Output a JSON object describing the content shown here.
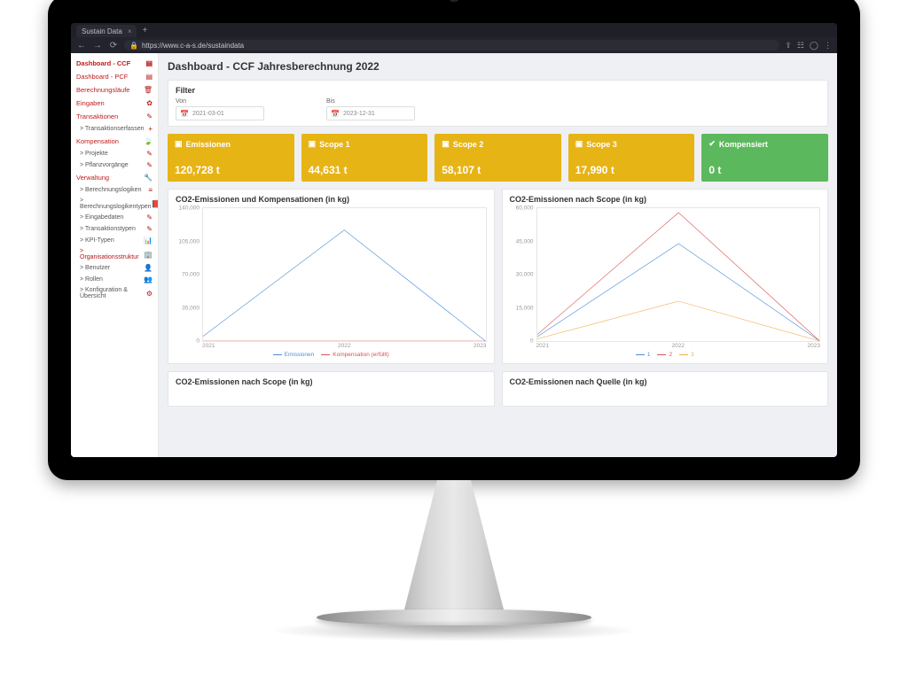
{
  "browser": {
    "tab_title": "Sustain Data",
    "url": "https://www.c-a-s.de/sustaindata"
  },
  "sidebar": {
    "items": [
      {
        "label": "Dashboard - CCF",
        "icon": "dashboard-icon",
        "glyph": "▤",
        "active": true
      },
      {
        "label": "Dashboard - PCF",
        "icon": "dashboard-icon",
        "glyph": "▤"
      },
      {
        "label": "Berechnungsläufe",
        "icon": "delete-icon",
        "glyph": "🗑"
      },
      {
        "label": "Eingaben",
        "icon": "settings-icon",
        "glyph": "✿"
      },
      {
        "label": "Transaktionen",
        "icon": "pencil-icon",
        "glyph": "✎"
      },
      {
        "label": "> Transaktionserfassen",
        "icon": "plus-icon",
        "glyph": "+",
        "sub": true
      },
      {
        "label": "Kompensation",
        "icon": "leaf-icon",
        "glyph": "🍃"
      },
      {
        "label": "> Projekte",
        "icon": "pencil-icon",
        "glyph": "✎",
        "sub": true
      },
      {
        "label": "> Pflanzvorgänge",
        "icon": "pencil-icon",
        "glyph": "✎",
        "sub": true
      },
      {
        "label": "Verwaltung",
        "icon": "wrench-icon",
        "glyph": "🔧"
      },
      {
        "label": "> Berechnungslogiken",
        "icon": "list-icon",
        "glyph": "≡",
        "sub": true
      },
      {
        "label": "> Berechnungslogikentypen",
        "icon": "book-icon",
        "glyph": "📕",
        "sub": true
      },
      {
        "label": "> Eingabedaten",
        "icon": "pencil-icon",
        "glyph": "✎",
        "sub": true
      },
      {
        "label": "> Transaktionstypen",
        "icon": "pencil-icon",
        "glyph": "✎",
        "sub": true
      },
      {
        "label": "> KPI-Typen",
        "icon": "chart-icon",
        "glyph": "📊",
        "sub": true
      },
      {
        "label": "> Organisationsstruktur",
        "icon": "org-icon",
        "glyph": "🏢",
        "sub": true,
        "active": true
      },
      {
        "label": "> Benutzer",
        "icon": "user-icon",
        "glyph": "👤",
        "sub": true
      },
      {
        "label": "> Rollen",
        "icon": "users-icon",
        "glyph": "👥",
        "sub": true
      },
      {
        "label": "> Konfiguration & Übersicht",
        "icon": "sliders-icon",
        "glyph": "⚙",
        "sub": true
      }
    ]
  },
  "page": {
    "title": "Dashboard - CCF Jahresberechnung 2022",
    "filter": {
      "title": "Filter",
      "from_label": "Von",
      "from_value": "2021-03-01",
      "to_label": "Bis",
      "to_value": "2023-12-31"
    },
    "cards": [
      {
        "icon": "folder-icon",
        "label": "Emissionen",
        "value": "120,728 t",
        "color": "yellow"
      },
      {
        "icon": "folder-icon",
        "label": "Scope 1",
        "value": "44,631 t",
        "color": "yellow"
      },
      {
        "icon": "folder-icon",
        "label": "Scope 2",
        "value": "58,107 t",
        "color": "yellow"
      },
      {
        "icon": "folder-icon",
        "label": "Scope 3",
        "value": "17,990 t",
        "color": "yellow"
      },
      {
        "icon": "check-icon",
        "label": "Kompensiert",
        "value": "0 t",
        "color": "green"
      }
    ],
    "chart1": {
      "title": "CO2-Emissionen und Kompensationen (in kg)"
    },
    "chart2": {
      "title": "CO2-Emissionen nach Scope (in kg)"
    },
    "chart3": {
      "title": "CO2-Emissionen nach Scope (in kg)"
    },
    "chart4": {
      "title": "CO2-Emissionen nach Quelle (in kg)"
    }
  },
  "chart_data": [
    {
      "type": "line",
      "title": "CO2-Emissionen und Kompensationen (in kg)",
      "x": [
        "2021",
        "2022",
        "2023"
      ],
      "series": [
        {
          "name": "Emissionen",
          "values": [
            5000,
            117000,
            0
          ],
          "color": "#4a90d9"
        },
        {
          "name": "Kompensation (erfüllt)",
          "values": [
            0,
            0,
            0
          ],
          "color": "#d9534f"
        }
      ],
      "ylim": [
        0,
        140000
      ],
      "yticks": [
        0,
        35000,
        70000,
        105000,
        140000
      ],
      "xlabel": "",
      "ylabel": ""
    },
    {
      "type": "line",
      "title": "CO2-Emissionen nach Scope (in kg)",
      "x": [
        "2021",
        "2022",
        "2023"
      ],
      "series": [
        {
          "name": "1",
          "values": [
            2000,
            44000,
            0
          ],
          "color": "#4a90d9"
        },
        {
          "name": "2",
          "values": [
            3000,
            58000,
            0
          ],
          "color": "#d9534f"
        },
        {
          "name": "3",
          "values": [
            1000,
            18000,
            0
          ],
          "color": "#f0ad4e"
        }
      ],
      "ylim": [
        0,
        60000
      ],
      "yticks": [
        0,
        15000,
        30000,
        45000,
        60000
      ],
      "xlabel": "",
      "ylabel": ""
    }
  ]
}
